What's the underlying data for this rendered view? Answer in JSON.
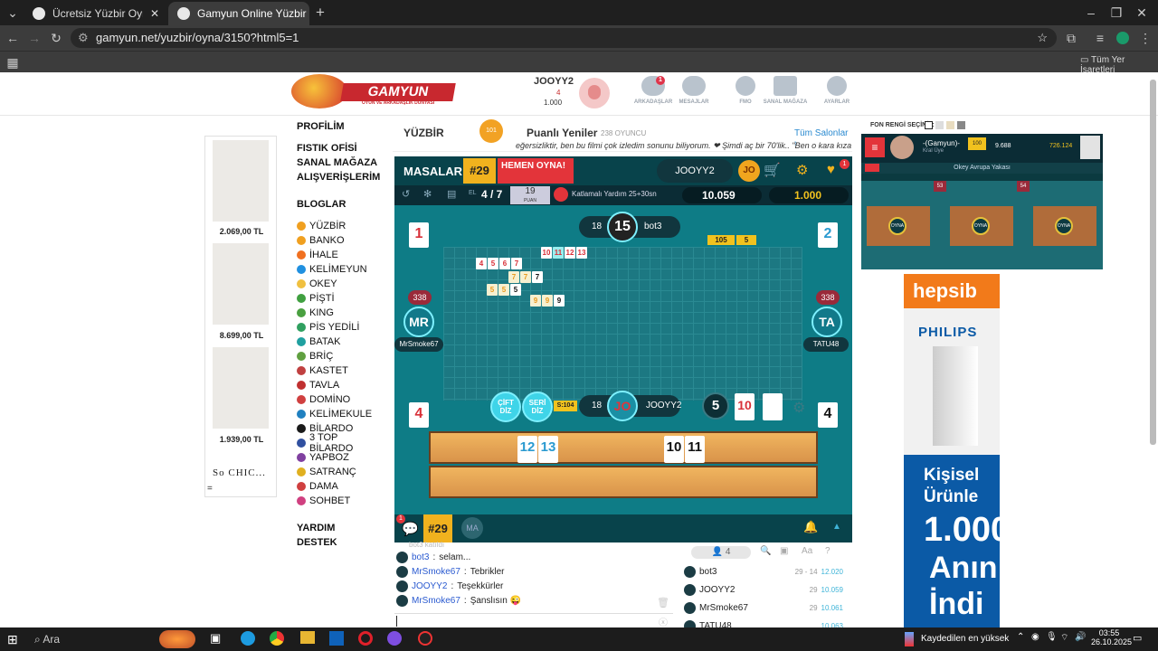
{
  "browser": {
    "tabs": [
      {
        "title": "Ücretsiz Yüzbir Oyna - Salon Li"
      },
      {
        "title": "Gamyun Online Yüzbir"
      }
    ],
    "url": "gamyun.net/yuzbir/oyna/3150?html5=1",
    "bookmarks_label": "Tüm Yer İşaretleri"
  },
  "header": {
    "logo": "GAMYUN",
    "logo_tagline": "OYUN VE ARKADAŞLIK DÜNYASI",
    "user": {
      "name": "JOOYY2",
      "level": "4",
      "coins": "1.000"
    },
    "nav": [
      {
        "label": "ARKADAŞLAR",
        "badge": "1"
      },
      {
        "label": "MESAJLAR",
        "badge": ""
      },
      {
        "label": "FMO",
        "badge": ""
      },
      {
        "label": "SANAL MAĞAZA",
        "badge": ""
      },
      {
        "label": "AYARLAR",
        "badge": ""
      }
    ]
  },
  "left_ads": {
    "prices": [
      "2.069,00 TL",
      "8.699,00 TL",
      "1.939,00 TL"
    ],
    "brand": "So CHIC...",
    "extra": "="
  },
  "menu": {
    "heads": [
      "PROFİLİM",
      "FISTIK OFİSİ",
      "SANAL MAĞAZA",
      "ALIŞVERİŞLERİM",
      "BLOGLAR",
      "YARDIM",
      "DESTEK"
    ],
    "games": [
      {
        "label": "YÜZBİR",
        "color": "#f0a020"
      },
      {
        "label": "BANKO",
        "color": "#f0a020"
      },
      {
        "label": "İHALE",
        "color": "#f07020"
      },
      {
        "label": "KELİMEYUN",
        "color": "#2090e0"
      },
      {
        "label": "OKEY",
        "color": "#f0c040"
      },
      {
        "label": "PİŞTİ",
        "color": "#40a040"
      },
      {
        "label": "KING",
        "color": "#4aa040"
      },
      {
        "label": "PİS YEDİLİ",
        "color": "#30a060"
      },
      {
        "label": "BATAK",
        "color": "#20a0a0"
      },
      {
        "label": "BRİÇ",
        "color": "#60a040"
      },
      {
        "label": "KASTET",
        "color": "#c04040"
      },
      {
        "label": "TAVLA",
        "color": "#c03030"
      },
      {
        "label": "DOMİNO",
        "color": "#d04040"
      },
      {
        "label": "KELİMEKULE",
        "color": "#2080c0"
      },
      {
        "label": "BİLARDO",
        "color": "#1a1a1a"
      },
      {
        "label": "3 TOP BİLARDO",
        "color": "#3050a0"
      },
      {
        "label": "YAPBOZ",
        "color": "#8040a0"
      },
      {
        "label": "SATRANÇ",
        "color": "#e0b020"
      },
      {
        "label": "DAMA",
        "color": "#d04040"
      },
      {
        "label": "SOHBET",
        "color": "#d04080"
      }
    ]
  },
  "game_header": {
    "title": "YÜZBİR",
    "room": "Puanlı Yeniler",
    "players": "238 OYUNCU",
    "all_rooms": "Tüm Salonlar",
    "ticker": "eğersizliktir, ben bu filmi çok izledim sonunu biliyorum. ❤ Şimdi aç bir 70'lik.. \"Ben o kara kıza yı"
  },
  "game": {
    "tables_label": "MASALAR",
    "table_no": "#29",
    "cta": "HEMEN OYNA!",
    "user": "JOOYY2",
    "user_initials": "JO",
    "notif": "1",
    "round": "4 / 7",
    "el_label": "EL",
    "points": "19",
    "points_label": "PUAN",
    "rule": "Katlamalı Yardım 25+30sn",
    "score": "10.059",
    "coins": "1.000",
    "top_player": {
      "name": "bot3",
      "score": "18",
      "timer": "15"
    },
    "left_player": {
      "name": "MrSmoke67",
      "initials": "MR",
      "points": "338",
      "seat": "1"
    },
    "right_player": {
      "name": "TATU48",
      "initials": "TA",
      "points": "338",
      "seat": "2"
    },
    "bottom_player": {
      "name": "JOOYY2",
      "initials": "JO",
      "score": "18"
    },
    "seat3": "4",
    "seat4": "4",
    "deck_count": "46",
    "sum_label": "S:104",
    "btn_cift": "ÇİFT DİZ",
    "btn_seri": "SERİ DİZ",
    "remaining": "5",
    "indicator": "10",
    "top_runs": {
      "a": "105",
      "b": "5"
    },
    "board_rows": [
      [
        "10",
        "11",
        "12",
        "13"
      ],
      [
        "4",
        "5",
        "6",
        "7"
      ],
      [
        "7",
        "7",
        "7"
      ],
      [
        "5",
        "5",
        "5"
      ],
      [
        "9",
        "9",
        "9"
      ]
    ],
    "rack_tiles": [
      "12",
      "13",
      "10",
      "11"
    ]
  },
  "game_bottom": {
    "table": "#29",
    "initials": "MA",
    "chat_badge": "1",
    "chat": [
      {
        "user": "bot3",
        "text": "selam..."
      },
      {
        "user": "MrSmoke67",
        "text": "Tebrikler"
      },
      {
        "user": "JOOYY2",
        "text": "Teşekkürler"
      },
      {
        "user": "MrSmoke67",
        "text": "Şanslısın 😜"
      }
    ],
    "chat_top_faded": "bot3 katıldı",
    "online": "4",
    "player_list": [
      {
        "name": "bot3",
        "stat": "29 - 14",
        "score": "12.020"
      },
      {
        "name": "JOOYY2",
        "stat": "29",
        "score": "10.059"
      },
      {
        "name": "MrSmoke67",
        "stat": "29",
        "score": "10.061"
      },
      {
        "name": "TATU48",
        "stat": "",
        "score": "10.063"
      }
    ]
  },
  "right": {
    "bg_label": "FON RENGİ SEÇİNİZ:",
    "user": "-(Gamyun)-",
    "user_rank": "Kral Üye",
    "level": "100",
    "hearts": "9.688",
    "coins": "726.124",
    "room": "Okey Avrupa Yakası",
    "tables": [
      "53",
      "54"
    ],
    "play": "OYNA",
    "ad_brand": "hepsib",
    "ad_product": "PHILIPS",
    "ad_lines": [
      "Kişisel",
      "Ürünle",
      "1.000",
      "Anın",
      "İndi"
    ]
  },
  "taskbar": {
    "search": "Ara",
    "weather": "Kaydedilen en yüksek",
    "time": "03:55",
    "date": "26.10.2025"
  }
}
